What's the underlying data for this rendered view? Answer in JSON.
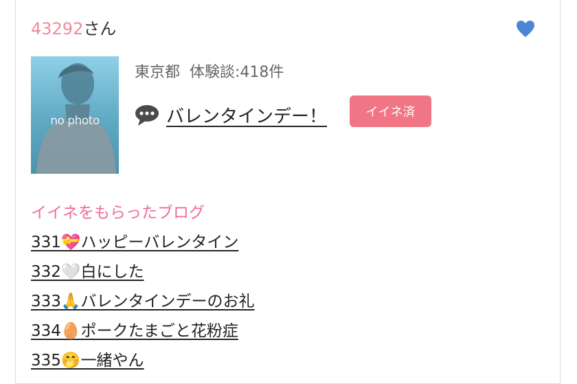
{
  "user": {
    "id": "43292",
    "suffix": "さん"
  },
  "profile": {
    "photo_placeholder": "no photo",
    "location": "東京都",
    "experience_label": "体験談:418件"
  },
  "post": {
    "title": "バレンタインデー！",
    "like_label": "イイネ済"
  },
  "liked_blogs": {
    "heading": "イイネをもらったブログ",
    "items": [
      {
        "num": "331",
        "emoji": "💝",
        "title": "ハッピーバレンタイン"
      },
      {
        "num": "332",
        "emoji": "🤍",
        "title": "白にした"
      },
      {
        "num": "333",
        "emoji": "🙏",
        "title": "バレンタインデーのお礼"
      },
      {
        "num": "334",
        "emoji": "🥚",
        "title": "ポークたまごと花粉症"
      },
      {
        "num": "335",
        "emoji": "🤭",
        "title": "一緒やん"
      }
    ]
  },
  "colors": {
    "accent_pink": "#f06aa0",
    "like_button": "#f07585",
    "heart_blue": "#4a86d4"
  },
  "icons": {
    "heart": "heart-icon",
    "chat": "speech-bubble-icon"
  }
}
